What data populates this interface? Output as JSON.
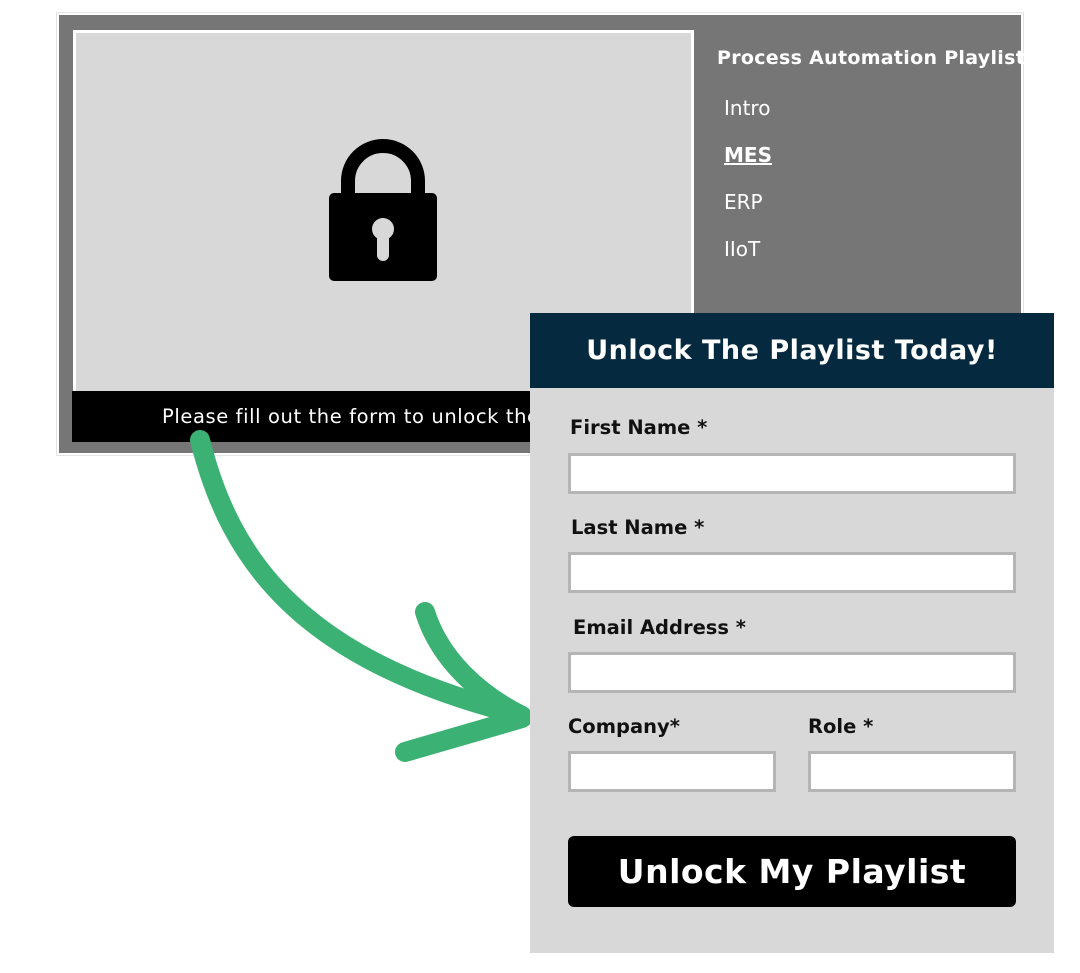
{
  "playlist": {
    "title": "Process Automation Playlist",
    "items": [
      {
        "label": "Intro",
        "active": false
      },
      {
        "label": "MES",
        "active": true
      },
      {
        "label": "ERP",
        "active": false
      },
      {
        "label": "IIoT",
        "active": false
      }
    ]
  },
  "video": {
    "locked_icon": "lock-icon",
    "caption": "Please fill out the form to unlock the playlist"
  },
  "form": {
    "title": "Unlock The Playlist Today!",
    "fields": {
      "first_name": {
        "label": "First Name *",
        "value": ""
      },
      "last_name": {
        "label": "Last Name *",
        "value": ""
      },
      "email": {
        "label": "Email Address *",
        "value": ""
      },
      "company": {
        "label": "Company*",
        "value": ""
      },
      "role": {
        "label": "Role *",
        "value": ""
      }
    },
    "submit_label": "Unlock My Playlist"
  },
  "decoration": {
    "arrow_icon": "curved-arrow-icon",
    "arrow_color": "#3bb273"
  },
  "colors": {
    "player_background": "#767676",
    "video_background": "#d8d8d8",
    "caption_bar": "#000000",
    "form_header": "#052a40",
    "form_background": "#d8d8d8",
    "button": "#000000"
  }
}
